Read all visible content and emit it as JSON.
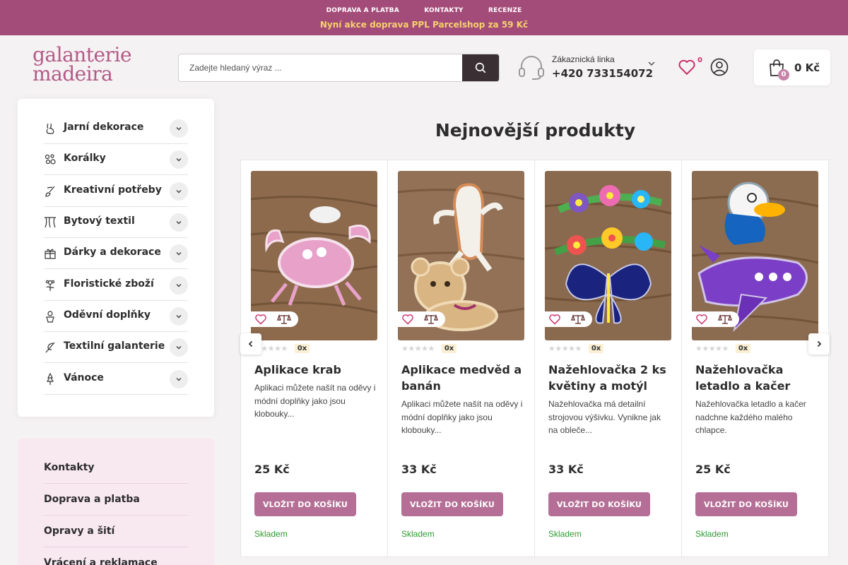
{
  "topbar": {
    "links": [
      "DOPRAVA A PLATBA",
      "KONTAKTY",
      "RECENZE"
    ],
    "promo": "Nyní akce doprava PPL Parcelshop za 59 Kč"
  },
  "header": {
    "logo_line1": "galanterie",
    "logo_line2": "madeira",
    "search_placeholder": "Zadejte hledaný výraz ...",
    "hotline_label": "Zákaznická linka",
    "hotline_phone": "+420 733154072",
    "wishlist_count": "0",
    "cart_count": "0",
    "cart_price": "0 Kč"
  },
  "categories": [
    {
      "label": "Jarní dekorace",
      "icon": "bunny-icon"
    },
    {
      "label": "Korálky",
      "icon": "beads-icon"
    },
    {
      "label": "Kreativní potřeby",
      "icon": "brush-icon"
    },
    {
      "label": "Bytový textil",
      "icon": "curtain-icon"
    },
    {
      "label": "Dárky a dekorace",
      "icon": "gift-icon"
    },
    {
      "label": "Floristické zboží",
      "icon": "flower-icon"
    },
    {
      "label": "Oděvní doplňky",
      "icon": "accessories-icon"
    },
    {
      "label": "Textilní galanterie",
      "icon": "needle-icon"
    },
    {
      "label": "Vánoce",
      "icon": "tree-icon"
    }
  ],
  "info_links": [
    "Kontakty",
    "Doprava a platba",
    "Opravy a šití",
    "Vrácení a reklamace"
  ],
  "main": {
    "title": "Nejnovější produkty",
    "buy_label": "VLOŽIT DO KOŠÍKU",
    "stock_label": "Skladem",
    "products": [
      {
        "title": "Aplikace krab",
        "desc": "Aplikaci můžete našít na oděvy i módní doplňky jako jsou klobouky...",
        "price": "25 Kč",
        "rating_count": "0x"
      },
      {
        "title": "Aplikace medvěd a banán",
        "desc": "Aplikaci můžete našít na oděvy i módní doplňky jako jsou klobouky...",
        "price": "33 Kč",
        "rating_count": "0x"
      },
      {
        "title": "Nažehlovačka 2 ks květiny a motýl",
        "desc": "Nažehlovačka má detailní strojovou výšivku. Vynikne jak na obleče...",
        "price": "33 Kč",
        "rating_count": "0x"
      },
      {
        "title": "Nažehlovačka letadlo a kačer",
        "desc": "Nažehlovačka letadlo a kačer nadchne každého malého chlapce.",
        "price": "25 Kč",
        "rating_count": "0x"
      }
    ]
  },
  "colors": {
    "brand": "#a44c79",
    "accent": "#b56f96",
    "promo": "#f5d26b",
    "stock": "#2e9b2e"
  }
}
